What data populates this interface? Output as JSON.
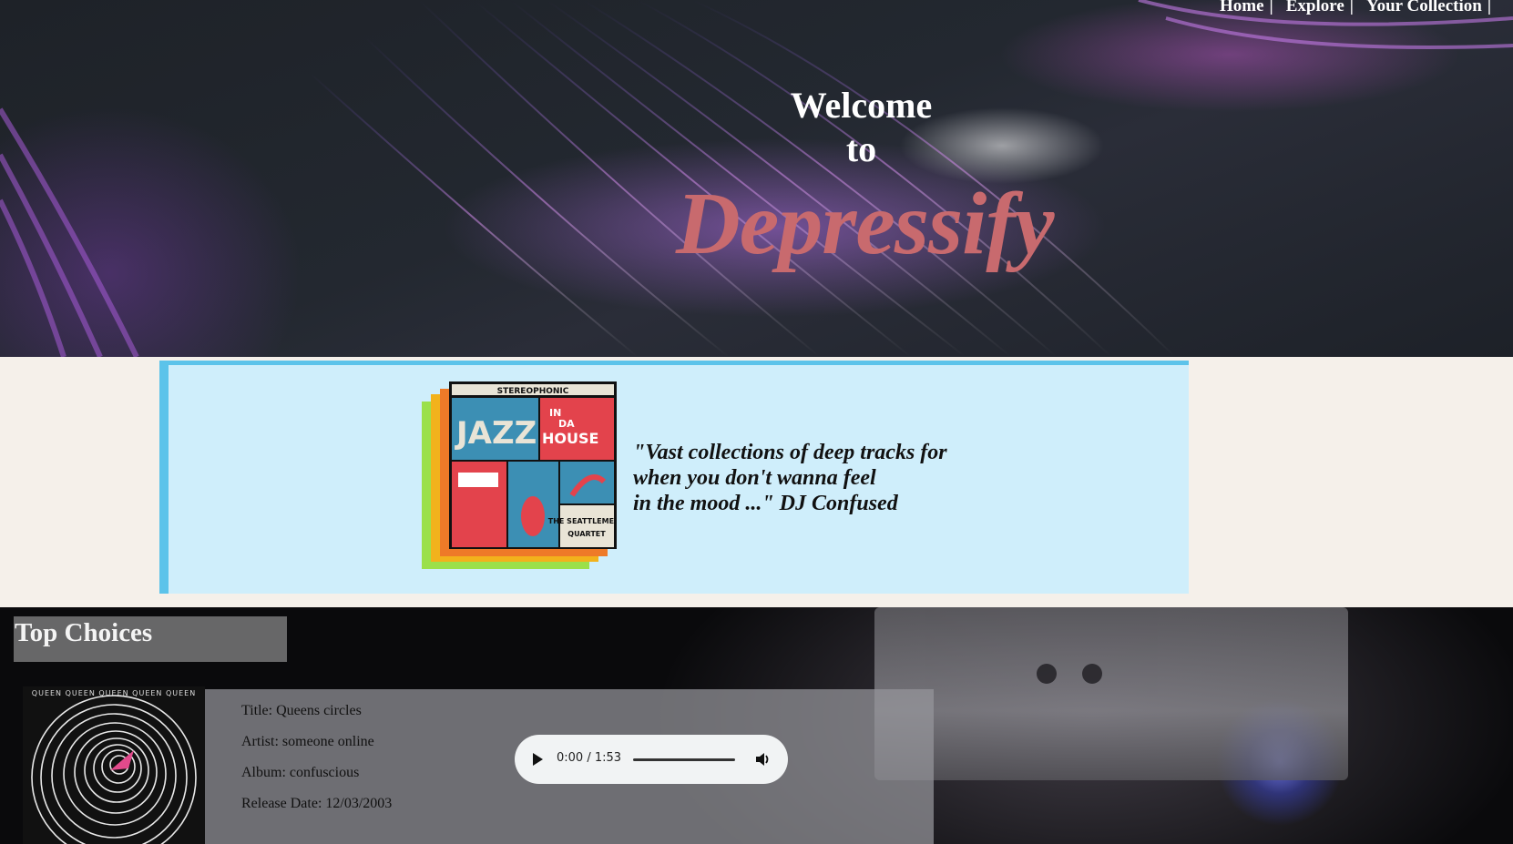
{
  "nav": {
    "items": [
      {
        "label": "Home"
      },
      {
        "label": "Explore"
      },
      {
        "label": "Your Collection"
      }
    ],
    "separator": "|"
  },
  "hero": {
    "welcome_line1": "Welcome",
    "welcome_line2": "to",
    "brand": "Depressify",
    "brand_color": "#c86a6e"
  },
  "banner": {
    "album_cover": {
      "header": "STEREOPHONIC",
      "title_jazz": "JAZZ",
      "title_in": "IN",
      "title_da": "DA",
      "title_house": "HOUSE",
      "credit_line1": "THE SEATTLEMENT",
      "credit_line2": "QUARTET"
    },
    "quote": "\"Vast collections of deep tracks for\nwhen you don't wanna feel\nin the mood ...\" DJ Confused"
  },
  "top_choices": {
    "title": "Top Choices",
    "tracks": [
      {
        "cover_band": "QUEEN QUEEN QUEEN QUEEN QUEEN",
        "title": "Title: Queens circles",
        "artist": "Artist: someone online",
        "album": "Album: confuscious",
        "release_date": "Release Date: 12/03/2003",
        "player_time": "0:00 / 1:53",
        "progress": 0
      }
    ]
  }
}
